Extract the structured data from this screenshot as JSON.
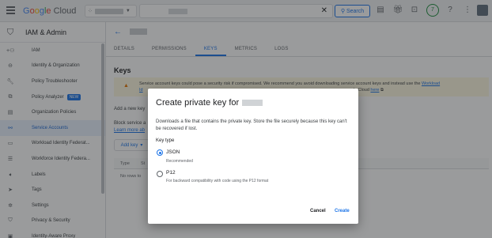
{
  "topbar": {
    "logo_text": "Google Cloud",
    "search_button": "Search",
    "notification_count": "7"
  },
  "sidebar": {
    "title": "IAM & Admin",
    "items": [
      {
        "label": "IAM",
        "icon": "person-add-icon"
      },
      {
        "label": "Identity & Organization",
        "icon": "identity-icon"
      },
      {
        "label": "Policy Troubleshooter",
        "icon": "wrench-icon"
      },
      {
        "label": "Policy Analyzer",
        "icon": "policy-icon",
        "badge": "NEW"
      },
      {
        "label": "Organization Policies",
        "icon": "list-icon"
      },
      {
        "label": "Service Accounts",
        "icon": "service-account-icon",
        "active": true
      },
      {
        "label": "Workload Identity Federat...",
        "icon": "id-card-icon"
      },
      {
        "label": "Workforce Identity Federa...",
        "icon": "list-lines-icon"
      },
      {
        "label": "Labels",
        "icon": "label-icon"
      },
      {
        "label": "Tags",
        "icon": "tag-icon"
      },
      {
        "label": "Settings",
        "icon": "settings-icon"
      },
      {
        "label": "Privacy & Security",
        "icon": "shield-icon"
      },
      {
        "label": "Identity-Aware Proxy",
        "icon": "proxy-icon"
      }
    ]
  },
  "main": {
    "tabs": [
      "DETAILS",
      "PERMISSIONS",
      "KEYS",
      "METRICS",
      "LOGS"
    ],
    "active_tab": "KEYS",
    "section_title": "Keys",
    "warning_line1": "Service account keys could pose a security risk if compromised. We recommend you avoid downloading service account keys and instead use the ",
    "warning_link1": "Workload",
    "warning_line2_prefix": "Id",
    "warning_line2_suffix": "ogle Cloud ",
    "warning_link2": "here",
    "add_new_key_text": "Add a new key",
    "block_text": "Block service a",
    "learn_more": "Learn more ab",
    "add_key_button": "Add key",
    "table_headers": [
      "Type",
      "St"
    ],
    "no_rows": "No rows to"
  },
  "dialog": {
    "title": "Create private key for",
    "description": "Downloads a file that contains the private key. Store the file securely because this key can't be recovered if lost.",
    "key_type_label": "Key type",
    "options": [
      {
        "label": "JSON",
        "help": "Recommended",
        "selected": true
      },
      {
        "label": "P12",
        "help": "For backward compatibility with code using the P12 format",
        "selected": false
      }
    ],
    "cancel": "Cancel",
    "create": "Create"
  },
  "colors": {
    "accent": "#1a73e8",
    "active_bg": "#e8f0fe",
    "warning_bg": "#fef7e0",
    "warning_icon": "#e37400"
  }
}
